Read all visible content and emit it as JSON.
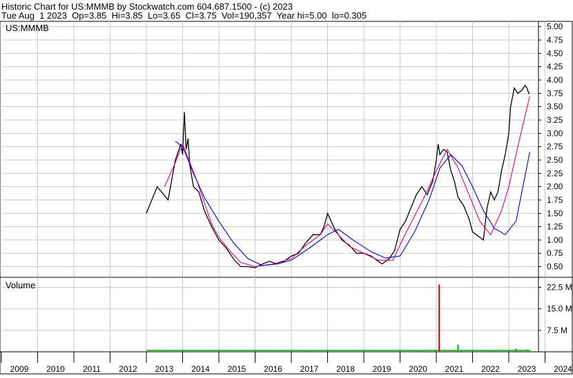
{
  "header": {
    "line1": "Historic Chart for US:MMMB by Stockwatch.com 604.687.1500 - (c) 2023",
    "line2": "Tue Aug  1 2023  Op=3.85  Hi=3.85  Lo=3.65  Cl=3.75  Vol=190,357  Year hi=5.00  lo=0.305"
  },
  "price_panel": {
    "symbol_label": "US:MMMB"
  },
  "volume_panel": {
    "label": "Volume"
  },
  "colors": {
    "price_line": "#000000",
    "ma_short": "#e0007a",
    "ma_long": "#0000cc",
    "volume_up": "#00aa00",
    "volume_down": "#cc0000",
    "grid": "#c8c8c8",
    "frame": "#000000"
  },
  "chart_data": [
    {
      "type": "line",
      "symbol": "US:MMMB",
      "x_unit": "year",
      "y_ticks": [
        0.5,
        0.75,
        1.0,
        1.25,
        1.5,
        1.75,
        2.0,
        2.25,
        2.5,
        2.75,
        3.0,
        3.25,
        3.5,
        3.75,
        4.0,
        4.25,
        4.5,
        4.75,
        5.0
      ],
      "y_tick_labels": [
        "0.50",
        "0.75",
        "1.00",
        "1.25",
        "1.50",
        "1.75",
        "2.00",
        "2.25",
        "2.50",
        "2.75",
        "3.00",
        "3.25",
        "3.50",
        "3.75",
        "4.00",
        "4.25",
        "4.50",
        "4.75",
        "5.00"
      ],
      "ylim": [
        0.3,
        5.1
      ],
      "xlim": [
        2009.0,
        2024.4
      ],
      "grid": true,
      "series": [
        {
          "role": "price",
          "x": [
            2013.0,
            2013.3,
            2013.6,
            2013.8,
            2013.95,
            2014.0,
            2014.05,
            2014.1,
            2014.15,
            2014.2,
            2014.3,
            2014.45,
            2014.6,
            2014.8,
            2015.0,
            2015.2,
            2015.4,
            2015.6,
            2015.8,
            2016.0,
            2016.2,
            2016.4,
            2016.6,
            2016.8,
            2017.0,
            2017.2,
            2017.4,
            2017.6,
            2017.8,
            2017.9,
            2018.0,
            2018.2,
            2018.4,
            2018.6,
            2018.8,
            2019.0,
            2019.2,
            2019.4,
            2019.5,
            2019.6,
            2019.7,
            2019.85,
            2020.0,
            2020.15,
            2020.3,
            2020.45,
            2020.6,
            2020.75,
            2020.9,
            2021.0,
            2021.05,
            2021.1,
            2021.2,
            2021.3,
            2021.4,
            2021.5,
            2021.6,
            2021.75,
            2021.9,
            2022.0,
            2022.1,
            2022.2,
            2022.3,
            2022.4,
            2022.5,
            2022.6,
            2022.7,
            2022.8,
            2022.9,
            2023.0,
            2023.05,
            2023.15,
            2023.25,
            2023.35,
            2023.45,
            2023.5,
            2023.55,
            2023.58
          ],
          "y": [
            1.5,
            2.0,
            1.75,
            2.5,
            2.8,
            2.6,
            3.4,
            2.7,
            2.9,
            2.4,
            2.0,
            1.9,
            1.55,
            1.25,
            1.0,
            0.85,
            0.65,
            0.5,
            0.5,
            0.48,
            0.55,
            0.6,
            0.55,
            0.6,
            0.7,
            0.75,
            0.95,
            1.1,
            1.1,
            1.25,
            1.5,
            1.2,
            1.0,
            0.9,
            0.75,
            0.75,
            0.7,
            0.6,
            0.55,
            0.6,
            0.65,
            0.8,
            1.2,
            1.35,
            1.6,
            1.85,
            2.0,
            1.85,
            2.1,
            2.5,
            2.8,
            2.6,
            2.7,
            2.65,
            2.3,
            2.1,
            1.8,
            1.65,
            1.4,
            1.15,
            1.1,
            1.05,
            1.0,
            1.6,
            1.9,
            1.75,
            1.9,
            2.3,
            2.6,
            3.0,
            3.5,
            3.85,
            3.75,
            3.8,
            3.9,
            3.85,
            3.75,
            3.75
          ]
        },
        {
          "role": "moving-average-short",
          "x": [
            2013.5,
            2013.8,
            2014.0,
            2014.2,
            2014.4,
            2014.6,
            2014.8,
            2015.0,
            2015.3,
            2015.6,
            2016.0,
            2016.5,
            2017.0,
            2017.4,
            2017.8,
            2018.0,
            2018.3,
            2018.6,
            2019.0,
            2019.4,
            2019.8,
            2020.1,
            2020.4,
            2020.7,
            2021.0,
            2021.3,
            2021.6,
            2021.9,
            2022.2,
            2022.5,
            2022.8,
            2023.0,
            2023.3,
            2023.58
          ],
          "y": [
            2.0,
            2.45,
            2.8,
            2.45,
            2.1,
            1.7,
            1.3,
            1.05,
            0.8,
            0.58,
            0.5,
            0.55,
            0.65,
            0.9,
            1.1,
            1.3,
            1.1,
            0.88,
            0.75,
            0.62,
            0.62,
            1.05,
            1.45,
            1.85,
            2.3,
            2.7,
            2.35,
            1.85,
            1.35,
            1.1,
            1.55,
            2.0,
            2.9,
            3.7
          ]
        },
        {
          "role": "moving-average-long",
          "x": [
            2013.8,
            2014.0,
            2014.3,
            2014.6,
            2015.0,
            2015.4,
            2015.8,
            2016.2,
            2016.6,
            2017.0,
            2017.5,
            2018.0,
            2018.3,
            2018.7,
            2019.2,
            2019.6,
            2020.0,
            2020.4,
            2020.8,
            2021.1,
            2021.4,
            2021.7,
            2022.0,
            2022.3,
            2022.6,
            2022.9,
            2023.2,
            2023.58
          ],
          "y": [
            2.85,
            2.75,
            2.25,
            1.8,
            1.35,
            0.95,
            0.65,
            0.52,
            0.55,
            0.62,
            0.85,
            1.1,
            1.2,
            1.0,
            0.78,
            0.66,
            0.7,
            1.15,
            1.75,
            2.35,
            2.6,
            2.4,
            2.0,
            1.55,
            1.22,
            1.1,
            1.35,
            2.65
          ]
        }
      ]
    },
    {
      "type": "bar",
      "title": "Volume",
      "y_ticks": [
        7.5,
        15.0,
        22.5
      ],
      "y_tick_labels": [
        "7.5 M",
        "15.0 M",
        "22.5 M"
      ],
      "ylim": [
        0,
        26
      ],
      "grid": true,
      "series": [
        {
          "name": "Volume",
          "x": [
            2013.1,
            2013.5,
            2014.0,
            2014.5,
            2015.0,
            2015.5,
            2016.0,
            2016.5,
            2017.0,
            2017.5,
            2018.0,
            2018.5,
            2019.0,
            2019.5,
            2020.0,
            2020.5,
            2020.95,
            2021.08,
            2021.4,
            2021.6,
            2022.0,
            2022.5,
            2023.0,
            2023.2,
            2023.5
          ],
          "y": [
            0.3,
            0.3,
            0.4,
            0.3,
            0.3,
            0.3,
            0.3,
            0.3,
            0.3,
            0.4,
            0.4,
            0.3,
            0.3,
            0.3,
            0.4,
            0.5,
            0.5,
            23.5,
            0.6,
            2.5,
            0.5,
            0.4,
            0.6,
            1.1,
            0.8
          ],
          "colors": [
            "up",
            "up",
            "up",
            "up",
            "up",
            "up",
            "up",
            "up",
            "up",
            "up",
            "up",
            "up",
            "up",
            "up",
            "up",
            "up",
            "up",
            "down",
            "up",
            "up",
            "up",
            "up",
            "up",
            "up",
            "up"
          ]
        }
      ]
    },
    {
      "type": "table",
      "role": "year-axis",
      "categories": [
        "2009",
        "2010",
        "2011",
        "2012",
        "2013",
        "2014",
        "2015",
        "2016",
        "2017",
        "2018",
        "2019",
        "2020",
        "2021",
        "2022",
        "2023",
        "2024"
      ]
    }
  ]
}
